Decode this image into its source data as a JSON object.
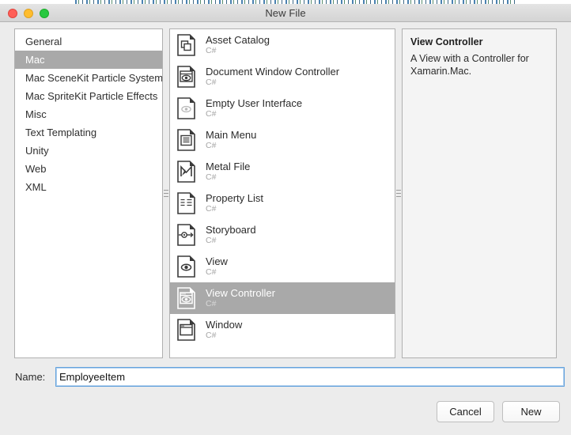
{
  "window": {
    "title": "New File",
    "traffic_lights": [
      "close-button",
      "minimize-button",
      "zoom-button"
    ]
  },
  "categories": {
    "selected": "Mac",
    "items": [
      {
        "label": "General",
        "selected": false
      },
      {
        "label": "Mac",
        "selected": true
      },
      {
        "label": "Mac SceneKit Particle Systems",
        "selected": false
      },
      {
        "label": "Mac SpriteKit Particle Effects",
        "selected": false
      },
      {
        "label": "Misc",
        "selected": false
      },
      {
        "label": "Text Templating",
        "selected": false
      },
      {
        "label": "Unity",
        "selected": false
      },
      {
        "label": "Web",
        "selected": false
      },
      {
        "label": "XML",
        "selected": false
      }
    ]
  },
  "templates": {
    "selected": "View Controller",
    "items": [
      {
        "title": "Asset Catalog",
        "language": "C#",
        "icon": "asset-catalog-icon",
        "selected": false
      },
      {
        "title": "Document Window Controller",
        "language": "C#",
        "icon": "document-window-controller-icon",
        "selected": false
      },
      {
        "title": "Empty User Interface",
        "language": "C#",
        "icon": "empty-user-interface-icon",
        "selected": false
      },
      {
        "title": "Main Menu",
        "language": "C#",
        "icon": "main-menu-icon",
        "selected": false
      },
      {
        "title": "Metal File",
        "language": "C#",
        "icon": "metal-file-icon",
        "selected": false
      },
      {
        "title": "Property List",
        "language": "C#",
        "icon": "property-list-icon",
        "selected": false
      },
      {
        "title": "Storyboard",
        "language": "C#",
        "icon": "storyboard-icon",
        "selected": false
      },
      {
        "title": "View",
        "language": "C#",
        "icon": "view-icon",
        "selected": false
      },
      {
        "title": "View Controller",
        "language": "C#",
        "icon": "view-controller-icon",
        "selected": true
      },
      {
        "title": "Window",
        "language": "C#",
        "icon": "window-icon",
        "selected": false
      }
    ]
  },
  "description": {
    "title": "View Controller",
    "body": "A View with a Controller for Xamarin.Mac."
  },
  "name_field": {
    "label": "Name:",
    "value": "EmployeeItem",
    "placeholder": ""
  },
  "buttons": {
    "cancel": "Cancel",
    "new": "New"
  },
  "colors": {
    "selection": "#a9a9a9",
    "focus_ring": "#5b9dd9",
    "panel_bg": "#ffffff",
    "description_bg": "#f4f4f4",
    "window_bg": "#ececec"
  }
}
